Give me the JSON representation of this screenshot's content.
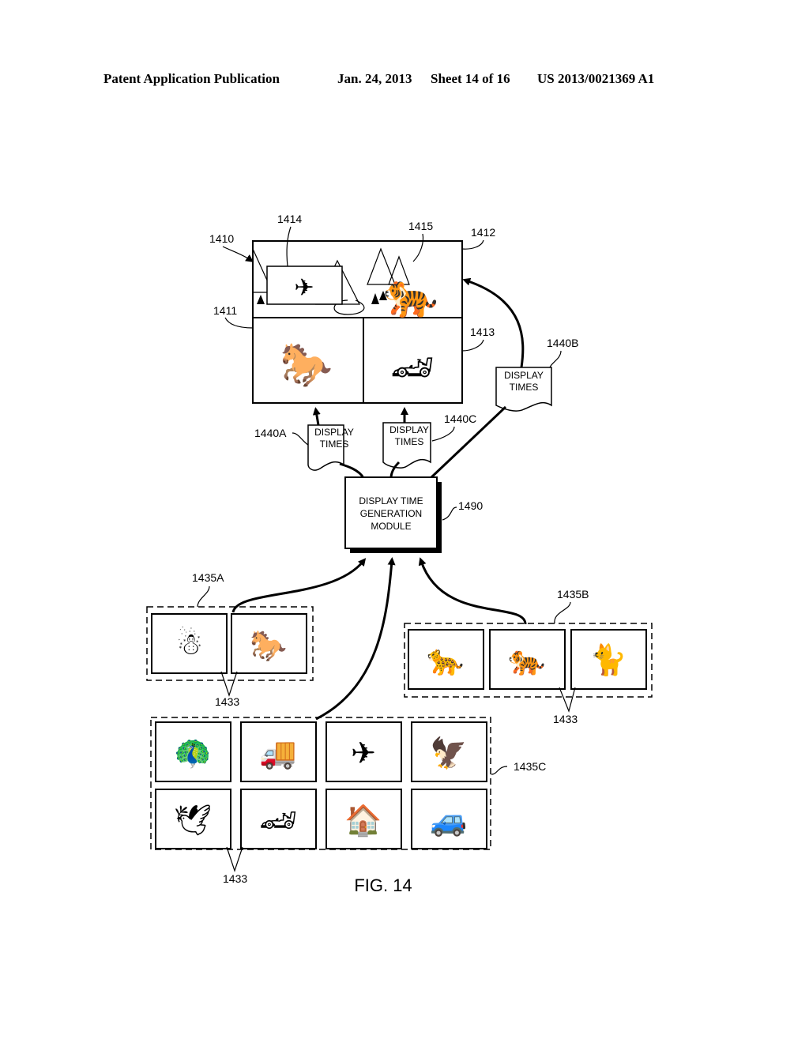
{
  "header": {
    "left": "Patent Application Publication",
    "date": "Jan. 24, 2013",
    "sheet": "Sheet 14 of 16",
    "number": "US 2013/0021369 A1"
  },
  "figure": {
    "caption": "FIG. 14",
    "display": {
      "ref": "1410",
      "region_top_left_ref": "1411",
      "region_top_right_ref": "1412",
      "region_bottom_right_ref": "1413",
      "inset_ref": "1414",
      "tiger_ref": "1415",
      "panels": [
        {
          "name": "landscape-with-airplane-and-tiger",
          "icons": [
            "airplane",
            "tiger",
            "trees"
          ]
        },
        {
          "name": "horse-riders",
          "icons": [
            "horse-riders"
          ]
        },
        {
          "name": "race-car",
          "icons": [
            "race-car"
          ]
        }
      ]
    },
    "display_times": [
      {
        "ref": "1440A",
        "line1": "DISPLAY",
        "line2": "TIMES"
      },
      {
        "ref": "1440B",
        "line1": "DISPLAY",
        "line2": "TIMES"
      },
      {
        "ref": "1440C",
        "line1": "DISPLAY",
        "line2": "TIMES"
      }
    ],
    "module": {
      "ref": "1490",
      "line1": "DISPLAY TIME",
      "line2": "GENERATION",
      "line3": "MODULE"
    },
    "groups": [
      {
        "ref": "1435A",
        "item_ref": "1433",
        "items": [
          "snowman-snowmobile",
          "horse-riders"
        ]
      },
      {
        "ref": "1435B",
        "item_ref": "1433",
        "items": [
          "cheetah",
          "tiger",
          "cat"
        ]
      },
      {
        "ref": "1435C",
        "item_ref": "1433",
        "items": [
          "peacock",
          "dump-truck",
          "fighter-jet",
          "eagle",
          "flying-bird",
          "race-car",
          "house",
          "pickup-truck"
        ]
      }
    ],
    "icon_glyphs": {
      "snowman-snowmobile": "☃",
      "horse-riders": "🐎",
      "cheetah": "🐆",
      "tiger": "🐅",
      "cat": "🐈",
      "peacock": "🦚",
      "dump-truck": "🚚",
      "fighter-jet": "✈",
      "eagle": "🦅",
      "flying-bird": "🕊",
      "race-car": "🏎",
      "house": "🏠",
      "pickup-truck": "🚙",
      "airplane": "✈",
      "trees": "▲"
    }
  }
}
